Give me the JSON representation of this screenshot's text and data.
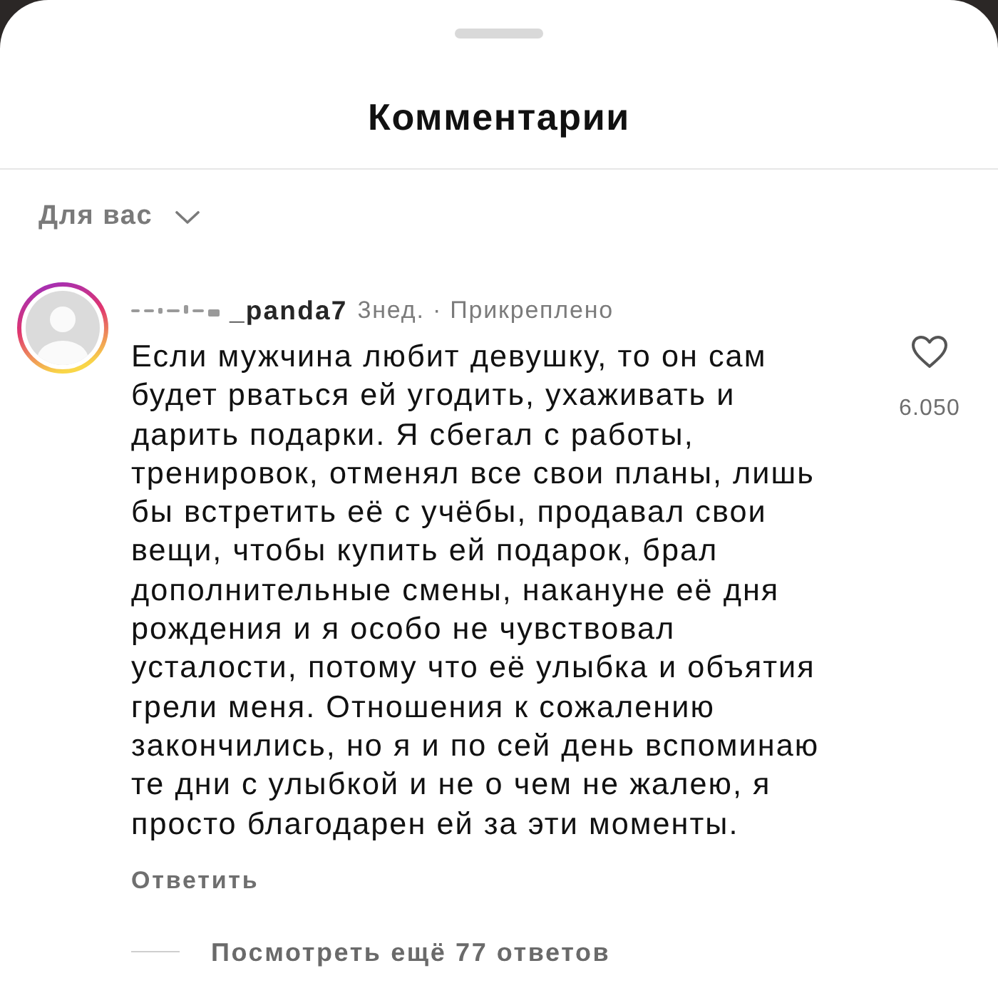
{
  "sheet": {
    "title": "Комментарии"
  },
  "filter": {
    "label": "Для вас"
  },
  "comment": {
    "username": "_panda7",
    "meta": "3нед. · Прикреплено",
    "text": "Если мужчина любит девушку, то он сам будет рваться ей угодить, ухаживать и дарить подарки. Я сбегал с работы, тренировок, отменял все свои планы, лишь бы встретить её с учёбы, продавал свои вещи, чтобы купить ей подарок, брал дополнительные смены, накануне её дня рождения и я особо не чувствовал усталости, потому что её улыбка и объятия грели меня. Отношения к сожалению закончились, но я и по сей день вспоминаю те дни с улыбкой и не о чем не жалею, я просто благодарен ей за эти моменты.",
    "liked": false,
    "likes": "6.050",
    "reply": "Ответить",
    "more_replies": "Посмотреть ещё 77 ответов"
  }
}
